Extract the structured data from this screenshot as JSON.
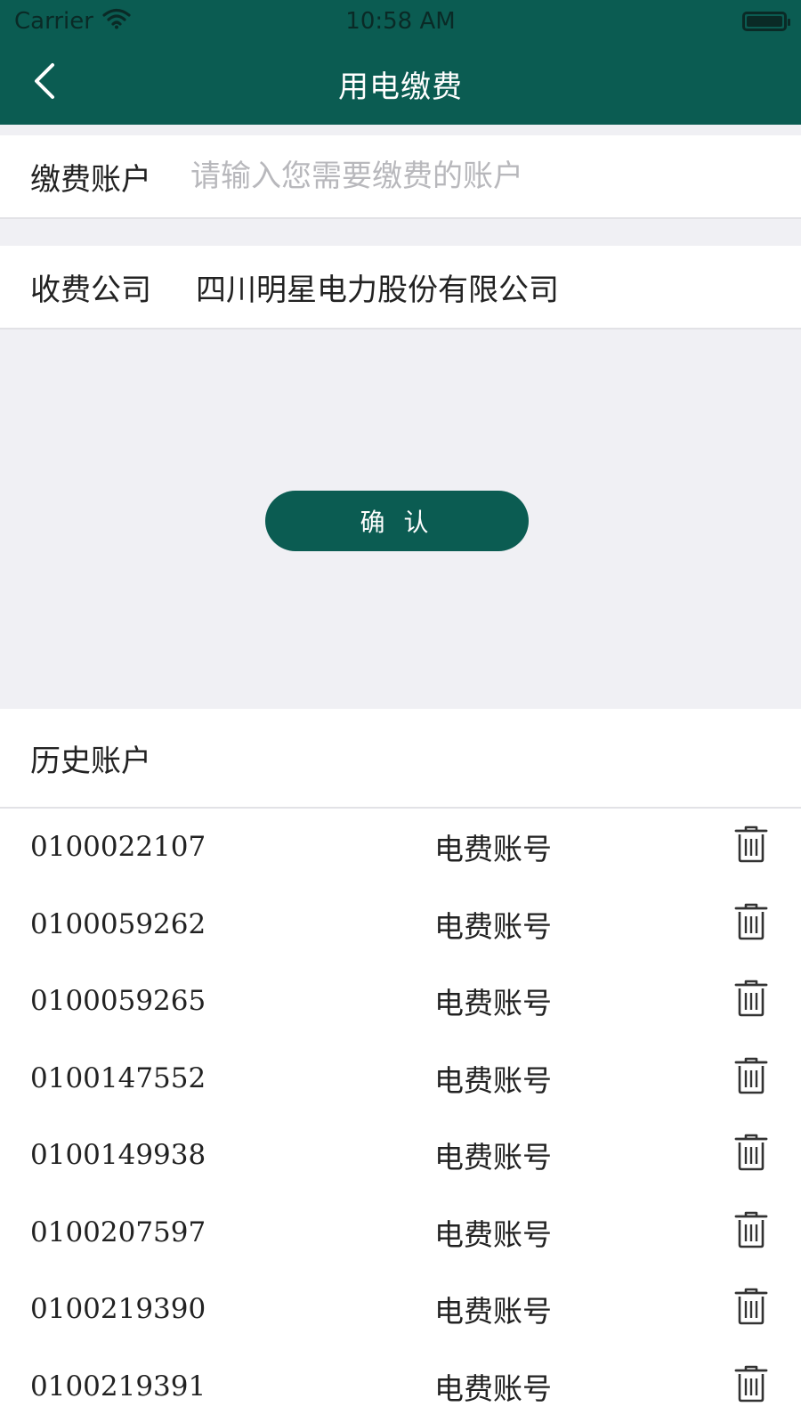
{
  "status_bar": {
    "carrier": "Carrier",
    "time": "10:58 AM"
  },
  "nav": {
    "title": "用电缴费"
  },
  "form": {
    "account_label": "缴费账户",
    "account_placeholder": "请输入您需要缴费的账户",
    "account_value": "",
    "company_label": "收费公司",
    "company_value": "四川明星电力股份有限公司"
  },
  "confirm_label": "确 认",
  "history": {
    "title": "历史账户",
    "items": [
      {
        "number": "0100022107",
        "type": "电费账号"
      },
      {
        "number": "0100059262",
        "type": "电费账号"
      },
      {
        "number": "0100059265",
        "type": "电费账号"
      },
      {
        "number": "0100147552",
        "type": "电费账号"
      },
      {
        "number": "0100149938",
        "type": "电费账号"
      },
      {
        "number": "0100207597",
        "type": "电费账号"
      },
      {
        "number": "0100219390",
        "type": "电费账号"
      },
      {
        "number": "0100219391",
        "type": "电费账号"
      }
    ]
  },
  "icons": {
    "back": "chevron-left-icon",
    "wifi": "wifi-icon",
    "battery": "battery-icon",
    "delete": "trash-icon"
  },
  "colors": {
    "brand": "#0b5c52",
    "background": "#f0f0f4",
    "placeholder": "#b8b8bc"
  }
}
